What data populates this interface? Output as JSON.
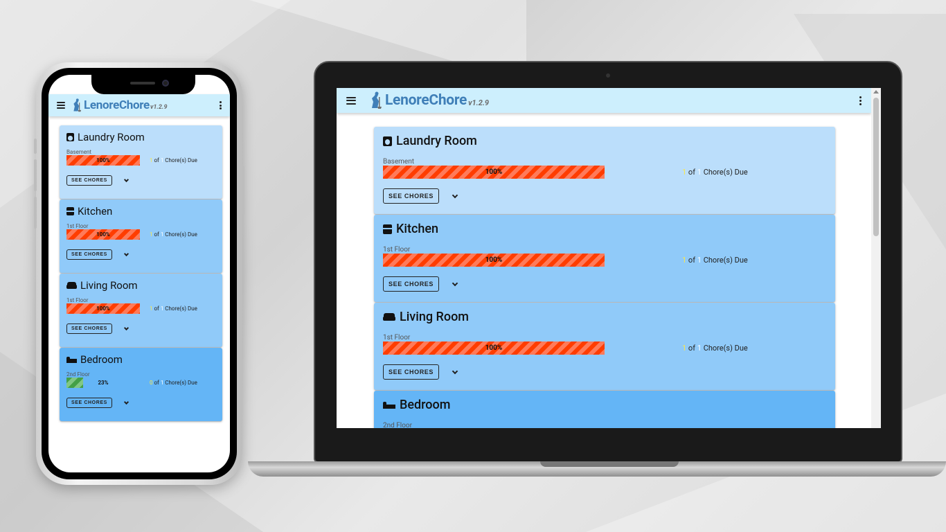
{
  "app": {
    "logo_lenore": "Lenore",
    "logo_chore": "Chore",
    "version": "v1.2.9",
    "colors": {
      "appbar": "#cdeffd",
      "logo": "#3f7fb8"
    }
  },
  "rooms": [
    {
      "name": "Laundry Room",
      "floor": "Basement",
      "icon": "washing-machine-icon",
      "percent": "100%",
      "fill": 1.0,
      "due_count": "1",
      "of_label": "of",
      "total": "1",
      "due_label": "Chore(s) Due",
      "button": "SEE CHORES",
      "color": "#bbdefb",
      "bar": "red"
    },
    {
      "name": "Kitchen",
      "floor": "1st Floor",
      "icon": "fridge-icon",
      "percent": "100%",
      "fill": 1.0,
      "due_count": "1",
      "of_label": "of",
      "total": "1",
      "due_label": "Chore(s) Due",
      "button": "SEE CHORES",
      "color": "#90caf9",
      "bar": "red"
    },
    {
      "name": "Living Room",
      "floor": "1st Floor",
      "icon": "sofa-icon",
      "percent": "100%",
      "fill": 1.0,
      "due_count": "1",
      "of_label": "of",
      "total": "1",
      "due_label": "Chore(s) Due",
      "button": "SEE CHORES",
      "color": "#90caf9",
      "bar": "red"
    },
    {
      "name": "Bedroom",
      "floor": "2nd Floor",
      "icon": "bed-icon",
      "percent": "23%",
      "fill": 0.23,
      "due_count": "0",
      "of_label": "of",
      "total": "1",
      "due_label": "Chore(s) Due",
      "button": "SEE CHORES",
      "color": "#64b5f6",
      "bar": "green"
    }
  ]
}
